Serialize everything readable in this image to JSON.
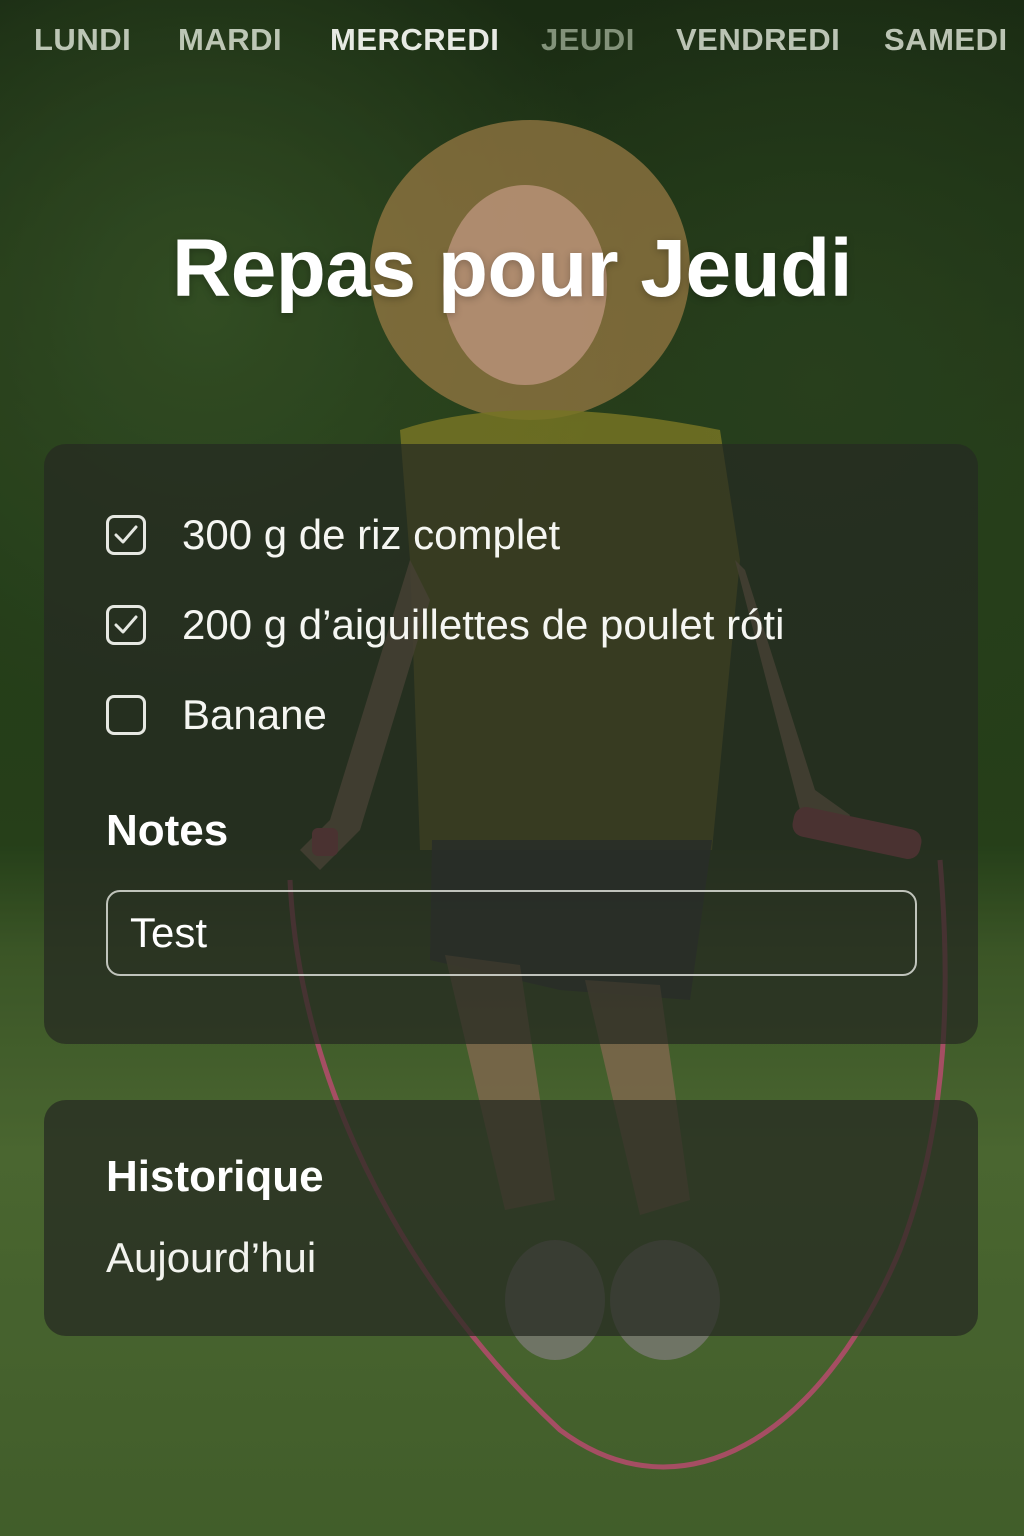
{
  "days": [
    {
      "label": "LUNDI"
    },
    {
      "label": "MARDI"
    },
    {
      "label": "MERCREDI"
    },
    {
      "label": "JEUDI"
    },
    {
      "label": "VENDREDI"
    },
    {
      "label": "SAMEDI"
    }
  ],
  "selected_day": "JEUDI",
  "title": "Repas pour Jeudi",
  "meals": {
    "items": [
      {
        "label": "300 g de riz complet",
        "checked": true
      },
      {
        "label": "200 g d’aiguillettes de poulet róti",
        "checked": true
      },
      {
        "label": "Banane",
        "checked": false
      }
    ]
  },
  "notes": {
    "heading": "Notes",
    "value": "Test"
  },
  "history": {
    "heading": "Historique",
    "entries": [
      "Aujourd’hui"
    ]
  },
  "icons": {
    "checkbox_checked": "checkbox-checked-icon",
    "checkbox_unchecked": "checkbox-unchecked-icon"
  },
  "colors": {
    "card_background": "#262a22",
    "text": "#ffffff",
    "tab_text": "#e8eee2"
  }
}
